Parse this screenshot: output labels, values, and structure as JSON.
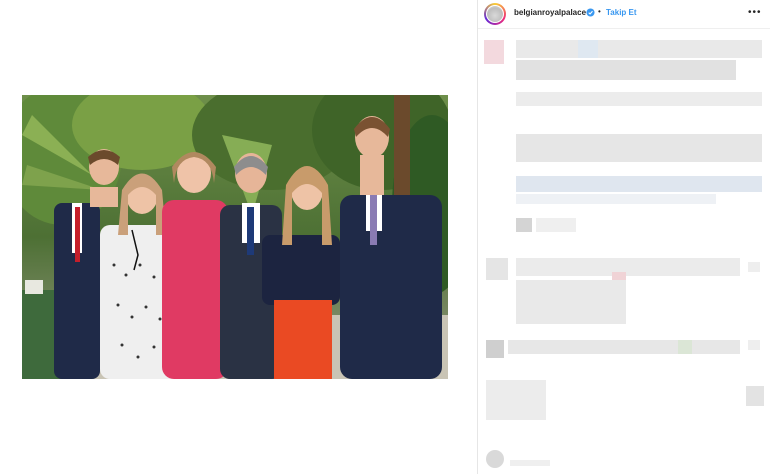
{
  "post": {
    "username": "belgianroyalpalace",
    "separator": "•",
    "follow_label": "Takip Et",
    "verified_icon": "verified-badge-icon",
    "more_icon": "more-options-icon",
    "more_glyph": "•••"
  },
  "colors": {
    "follow": "#3897f0",
    "text": "#262626",
    "border": "#efefef"
  }
}
